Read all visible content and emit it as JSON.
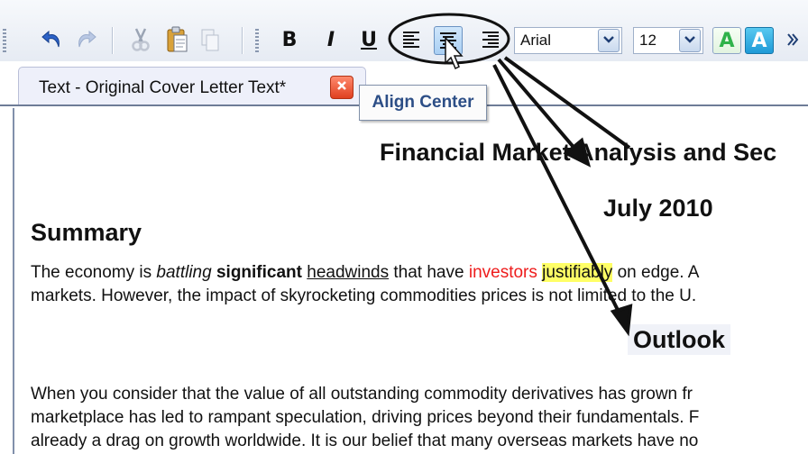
{
  "toolbar": {
    "font": {
      "value": "Arial"
    },
    "size": {
      "value": "12"
    },
    "bold_label": "B",
    "italic_label": "I",
    "underline_label": "U",
    "font_color_label": "A",
    "highlight_label": "A"
  },
  "tab": {
    "label": "Text - Original Cover Letter Text*"
  },
  "tooltip": "Align Center",
  "document": {
    "title": "Financial Market Analysis and Sec",
    "date": "July 2010",
    "summary_heading": "Summary",
    "p1": {
      "s1": "The economy is ",
      "s2": "battling",
      "s3": " ",
      "s4": "significant",
      "s5": " ",
      "s6": "headwinds",
      "s7": " that have ",
      "s8": "investors",
      "s9": " ",
      "s10": "justifiably",
      "s11": " on edge. A",
      "line2": "markets. However, the impact of skyrocketing commodities prices is not limited to the U."
    },
    "outlook_heading": "Outlook",
    "p2": {
      "line1": "When you consider that the value of all outstanding commodity derivatives has grown fr",
      "line2": "marketplace has led to rampant speculation, driving prices beyond their fundamentals. F",
      "line3": "already a drag on growth worldwide. It is our belief that many overseas markets have no"
    }
  }
}
